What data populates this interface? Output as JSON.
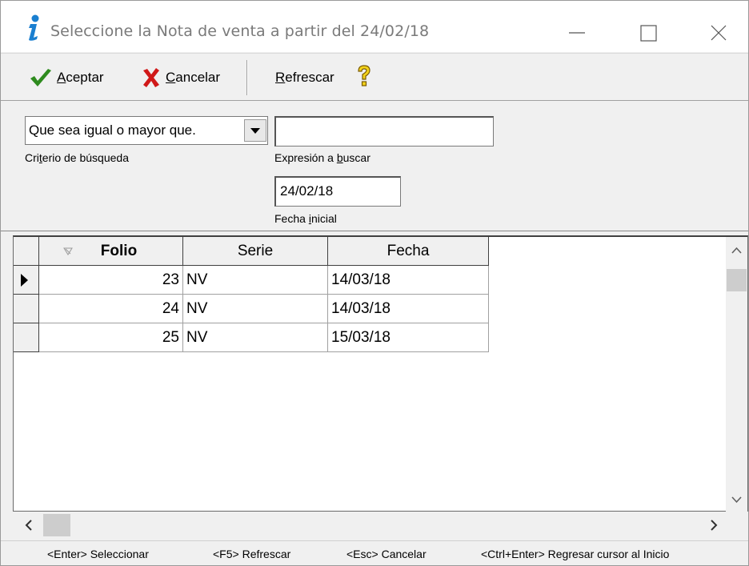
{
  "window": {
    "title": "Seleccione la Nota de venta a partir del 24/02/18"
  },
  "toolbar": {
    "accept_prefix": "A",
    "accept_rest": "ceptar",
    "cancel_prefix": "C",
    "cancel_rest": "ancelar",
    "refresh_prefix": "R",
    "refresh_rest": "efrescar"
  },
  "filter": {
    "criteria_value": "Que sea igual o mayor que.",
    "criteria_label_a": "Cri",
    "criteria_label_u": "t",
    "criteria_label_b": "erio de búsqueda",
    "expression_value": "",
    "expression_label_a": "Expresión a ",
    "expression_label_u": "b",
    "expression_label_b": "uscar",
    "start_date_value": "24/02/18",
    "start_date_label_a": "Fecha ",
    "start_date_label_u": "i",
    "start_date_label_b": "nicial"
  },
  "grid": {
    "columns": [
      "Folio",
      "Serie",
      "Fecha"
    ],
    "rows": [
      {
        "folio": "23",
        "serie": "NV",
        "fecha": "14/03/18"
      },
      {
        "folio": "24",
        "serie": "NV",
        "fecha": "14/03/18"
      },
      {
        "folio": "25",
        "serie": "NV",
        "fecha": "15/03/18"
      }
    ]
  },
  "statusbar": {
    "items": [
      "<Enter> Seleccionar",
      "<F5> Refrescar",
      "<Esc> Cancelar",
      "<Ctrl+Enter> Regresar cursor al Inicio"
    ]
  },
  "colors": {
    "accept_icon": "#2e8b1e",
    "cancel_icon": "#d01818",
    "info_icon": "#1a7fd0"
  }
}
